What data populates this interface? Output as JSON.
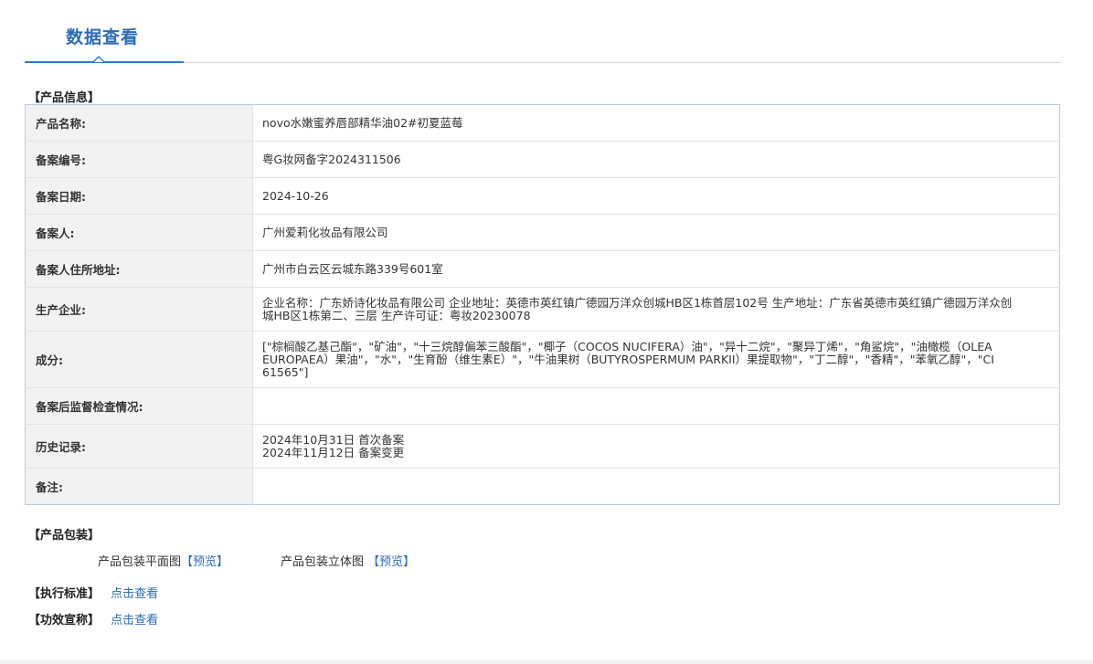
{
  "header": {
    "title": "数据查看"
  },
  "product_info": {
    "section_title": "【产品信息】",
    "rows": [
      {
        "label": "产品名称:",
        "value": "novo水嫩蜜养唇部精华油02#初夏蓝莓"
      },
      {
        "label": "备案编号:",
        "value": "粤G妆网备字2024311506"
      },
      {
        "label": "备案日期:",
        "value": "2024-10-26"
      },
      {
        "label": "备案人:",
        "value": "广州爱莉化妆品有限公司"
      },
      {
        "label": "备案人住所地址:",
        "value": "广州市白云区云城东路339号601室"
      },
      {
        "label": "生产企业:",
        "value": "企业名称：广东娇诗化妆品有限公司 企业地址：英德市英红镇广德园万洋众创城HB区1栋首层102号 生产地址：广东省英德市英红镇广德园万洋众创城HB区1栋第二、三层 生产许可证：粤妆20230078"
      },
      {
        "label": "成分:",
        "value": "[\"棕榈酸乙基己酯\"，\"矿油\"，\"十三烷醇偏苯三酸酯\"，\"椰子（COCOS NUCIFERA）油\"，\"异十二烷\"，\"聚异丁烯\"，\"角鲨烷\"，\"油橄榄（OLEA EUROPAEA）果油\"，\"水\"，\"生育酚（维生素E）\"，\"牛油果树（BUTYROSPERMUM PARKII）果提取物\"，\"丁二醇\"，\"香精\"，\"苯氧乙醇\"，\"CI 61565\"]"
      },
      {
        "label": "备案后监督检查情况:",
        "value": ""
      },
      {
        "label": "历史记录:",
        "value": "2024年10月31日 首次备案",
        "value2": "2024年11月12日 备案变更"
      },
      {
        "label": "备注:",
        "value": ""
      }
    ]
  },
  "packaging": {
    "section_title": "【产品包装】",
    "flat_label": "产品包装平面图",
    "flat_link": "【预览】",
    "stereo_label": "产品包装立体图",
    "stereo_link": "【预览】"
  },
  "standard": {
    "label": "【执行标准】",
    "link": "点击查看"
  },
  "efficacy": {
    "label": "【功效宣称】",
    "link": "点击查看"
  }
}
